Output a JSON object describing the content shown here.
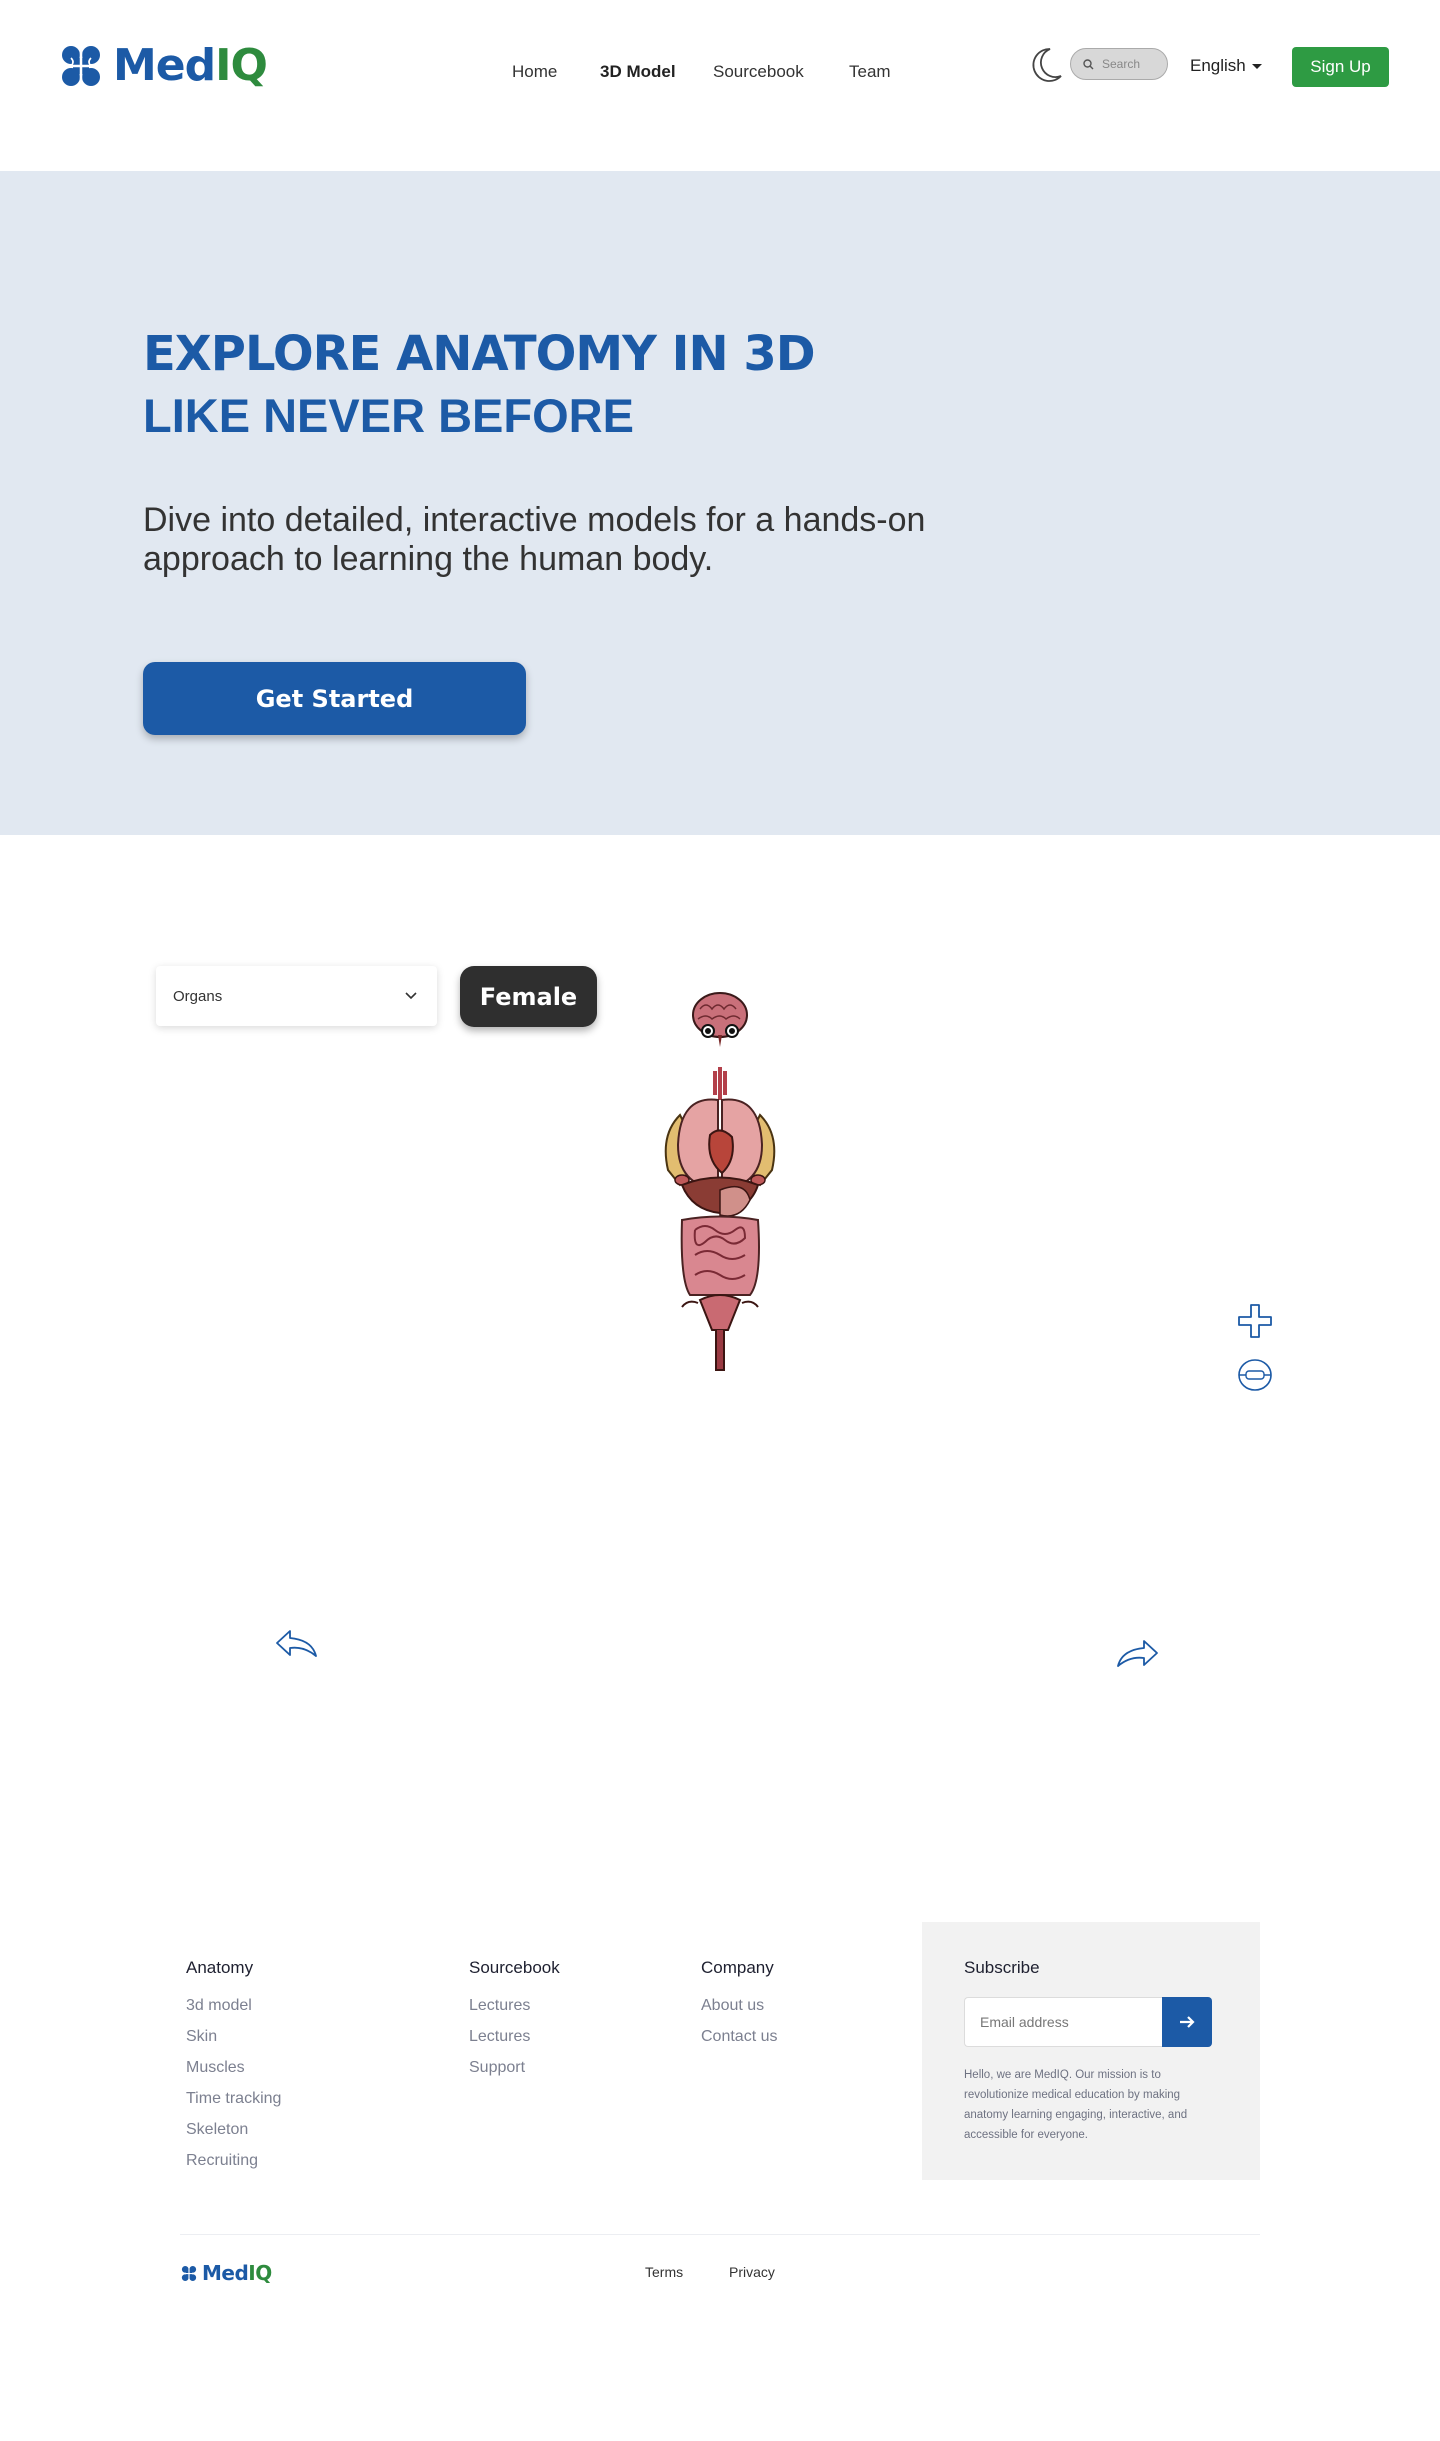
{
  "brand": {
    "name_part1": "Med",
    "name_part2": "IQ",
    "primary_color": "#1c5aa6",
    "accent_color": "#2e8b3e",
    "icon": "brain-clover-logo-icon"
  },
  "nav": {
    "items": [
      {
        "label": "Home",
        "active": false
      },
      {
        "label": "3D Model",
        "active": true
      },
      {
        "label": "Sourcebook",
        "active": false
      },
      {
        "label": "Team",
        "active": false
      }
    ]
  },
  "header": {
    "theme_toggle_icon": "moon-icon",
    "search_placeholder": "Search",
    "language": "English",
    "signup_label": "Sign Up",
    "signup_color": "#2e9b43"
  },
  "hero": {
    "title": "EXPLORE ANATOMY IN 3D",
    "subtitle": "LIKE NEVER BEFORE",
    "description": "Dive into detailed, interactive models for a hands-on approach to learning the human body.",
    "cta_label": "Get Started",
    "background": "#e1e8f1"
  },
  "viewer": {
    "system_select": {
      "selected": "Organs"
    },
    "gender_label": "Female",
    "model_icon": "human-organs-model",
    "controls": {
      "zoom_icon": "plus-icon",
      "reset_icon": "reset-view-icon",
      "rotate_left_icon": "rotate-left-arrow-icon",
      "rotate_right_icon": "rotate-right-arrow-icon"
    }
  },
  "footer": {
    "columns": [
      {
        "title": "Anatomy",
        "links": [
          "3d model",
          "Skin",
          "Muscles",
          "Time tracking",
          "Skeleton",
          "Recruiting"
        ]
      },
      {
        "title": "Sourcebook",
        "links": [
          "Lectures",
          "Lectures",
          "Support"
        ]
      },
      {
        "title": "Company",
        "links": [
          "About us",
          "Contact us"
        ]
      }
    ],
    "subscribe": {
      "title": "Subscribe",
      "email_placeholder": "Email address",
      "submit_icon": "arrow-right-icon",
      "text": "Hello, we are MedIQ. Our mission is to revolutionize medical education by making anatomy learning engaging, interactive, and accessible for everyone."
    },
    "bottom_links": [
      "Terms",
      "Privacy"
    ]
  }
}
